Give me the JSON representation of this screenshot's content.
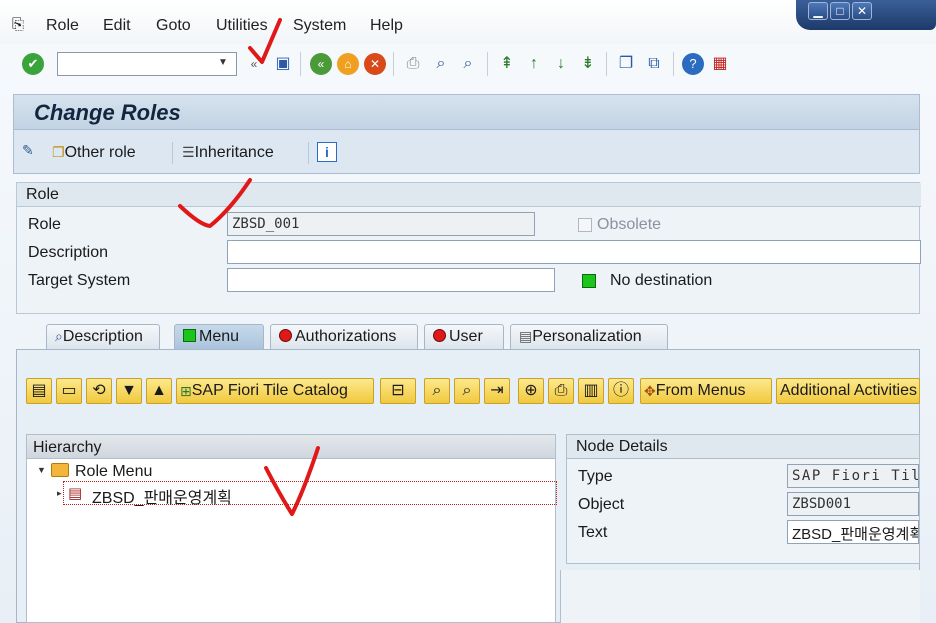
{
  "menubar": {
    "items": [
      {
        "label": "Role"
      },
      {
        "label": "Edit"
      },
      {
        "label": "Goto"
      },
      {
        "label": "Utilities"
      },
      {
        "label": "System"
      },
      {
        "label": "Help"
      }
    ]
  },
  "window_controls": {
    "minimize": "▁",
    "maximize": "□",
    "close": "✕"
  },
  "toolbar": {
    "command_field_value": "",
    "icons": [
      "enter-icon",
      "save-icon",
      "back-icon",
      "exit-icon",
      "cancel-icon",
      "print-icon",
      "find-icon",
      "find-next-icon",
      "first-page-icon",
      "previous-page-icon",
      "next-page-icon",
      "last-page-icon",
      "new-session-icon",
      "shortcut-icon",
      "help-icon",
      "customize-layout-icon"
    ]
  },
  "title": "Change Roles",
  "app_toolbar": {
    "other_role": "Other role",
    "inheritance": "Inheritance"
  },
  "role_frame": {
    "header": "Role",
    "role_label": "Role",
    "role_value": "ZBSD_001",
    "obsolete_label": "Obsolete",
    "description_label": "Description",
    "description_value": "",
    "target_system_label": "Target System",
    "target_system_value": "",
    "destination_status": "No destination",
    "destination_color": "#1cc41c"
  },
  "tabs": [
    {
      "label": "Description",
      "status_color": ""
    },
    {
      "label": "Menu",
      "status_color": "#1cc41c"
    },
    {
      "label": "Authorizations",
      "status_color": "#e01818"
    },
    {
      "label": "User",
      "status_color": "#e01818"
    },
    {
      "label": "Personalization",
      "status_color": ""
    }
  ],
  "menu_toolbar": {
    "fiori_catalog": "SAP Fiori Tile Catalog",
    "from_menus": "From Menus",
    "additional_activities": "Additional Activities"
  },
  "hierarchy": {
    "header": "Hierarchy",
    "root": "Role Menu",
    "child": "ZBSD_판매운영계획"
  },
  "node_details": {
    "header": "Node Details",
    "type_label": "Type",
    "type_value": "SAP Fiori Til",
    "object_label": "Object",
    "object_value": "ZBSD001",
    "text_label": "Text",
    "text_value": "ZBSD_판매운영계획"
  }
}
